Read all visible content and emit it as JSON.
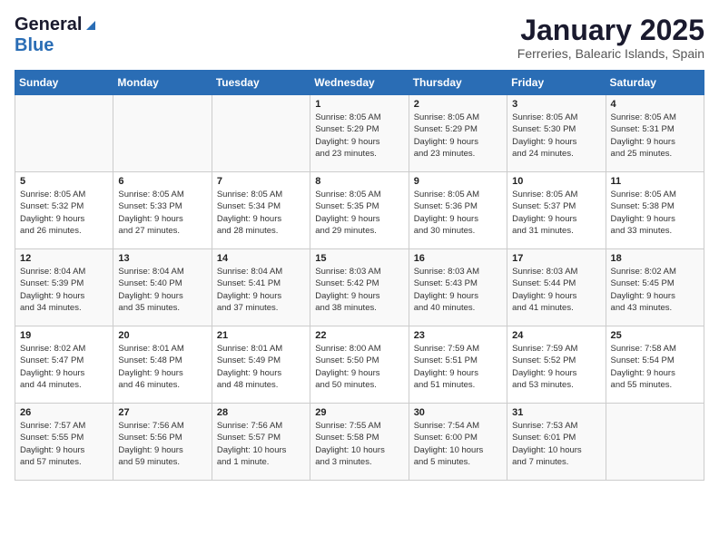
{
  "logo": {
    "general": "General",
    "blue": "Blue"
  },
  "title": "January 2025",
  "subtitle": "Ferreries, Balearic Islands, Spain",
  "weekdays": [
    "Sunday",
    "Monday",
    "Tuesday",
    "Wednesday",
    "Thursday",
    "Friday",
    "Saturday"
  ],
  "weeks": [
    [
      {
        "day": "",
        "content": ""
      },
      {
        "day": "",
        "content": ""
      },
      {
        "day": "",
        "content": ""
      },
      {
        "day": "1",
        "content": "Sunrise: 8:05 AM\nSunset: 5:29 PM\nDaylight: 9 hours\nand 23 minutes."
      },
      {
        "day": "2",
        "content": "Sunrise: 8:05 AM\nSunset: 5:29 PM\nDaylight: 9 hours\nand 23 minutes."
      },
      {
        "day": "3",
        "content": "Sunrise: 8:05 AM\nSunset: 5:30 PM\nDaylight: 9 hours\nand 24 minutes."
      },
      {
        "day": "4",
        "content": "Sunrise: 8:05 AM\nSunset: 5:31 PM\nDaylight: 9 hours\nand 25 minutes."
      }
    ],
    [
      {
        "day": "5",
        "content": "Sunrise: 8:05 AM\nSunset: 5:32 PM\nDaylight: 9 hours\nand 26 minutes."
      },
      {
        "day": "6",
        "content": "Sunrise: 8:05 AM\nSunset: 5:33 PM\nDaylight: 9 hours\nand 27 minutes."
      },
      {
        "day": "7",
        "content": "Sunrise: 8:05 AM\nSunset: 5:34 PM\nDaylight: 9 hours\nand 28 minutes."
      },
      {
        "day": "8",
        "content": "Sunrise: 8:05 AM\nSunset: 5:35 PM\nDaylight: 9 hours\nand 29 minutes."
      },
      {
        "day": "9",
        "content": "Sunrise: 8:05 AM\nSunset: 5:36 PM\nDaylight: 9 hours\nand 30 minutes."
      },
      {
        "day": "10",
        "content": "Sunrise: 8:05 AM\nSunset: 5:37 PM\nDaylight: 9 hours\nand 31 minutes."
      },
      {
        "day": "11",
        "content": "Sunrise: 8:05 AM\nSunset: 5:38 PM\nDaylight: 9 hours\nand 33 minutes."
      }
    ],
    [
      {
        "day": "12",
        "content": "Sunrise: 8:04 AM\nSunset: 5:39 PM\nDaylight: 9 hours\nand 34 minutes."
      },
      {
        "day": "13",
        "content": "Sunrise: 8:04 AM\nSunset: 5:40 PM\nDaylight: 9 hours\nand 35 minutes."
      },
      {
        "day": "14",
        "content": "Sunrise: 8:04 AM\nSunset: 5:41 PM\nDaylight: 9 hours\nand 37 minutes."
      },
      {
        "day": "15",
        "content": "Sunrise: 8:03 AM\nSunset: 5:42 PM\nDaylight: 9 hours\nand 38 minutes."
      },
      {
        "day": "16",
        "content": "Sunrise: 8:03 AM\nSunset: 5:43 PM\nDaylight: 9 hours\nand 40 minutes."
      },
      {
        "day": "17",
        "content": "Sunrise: 8:03 AM\nSunset: 5:44 PM\nDaylight: 9 hours\nand 41 minutes."
      },
      {
        "day": "18",
        "content": "Sunrise: 8:02 AM\nSunset: 5:45 PM\nDaylight: 9 hours\nand 43 minutes."
      }
    ],
    [
      {
        "day": "19",
        "content": "Sunrise: 8:02 AM\nSunset: 5:47 PM\nDaylight: 9 hours\nand 44 minutes."
      },
      {
        "day": "20",
        "content": "Sunrise: 8:01 AM\nSunset: 5:48 PM\nDaylight: 9 hours\nand 46 minutes."
      },
      {
        "day": "21",
        "content": "Sunrise: 8:01 AM\nSunset: 5:49 PM\nDaylight: 9 hours\nand 48 minutes."
      },
      {
        "day": "22",
        "content": "Sunrise: 8:00 AM\nSunset: 5:50 PM\nDaylight: 9 hours\nand 50 minutes."
      },
      {
        "day": "23",
        "content": "Sunrise: 7:59 AM\nSunset: 5:51 PM\nDaylight: 9 hours\nand 51 minutes."
      },
      {
        "day": "24",
        "content": "Sunrise: 7:59 AM\nSunset: 5:52 PM\nDaylight: 9 hours\nand 53 minutes."
      },
      {
        "day": "25",
        "content": "Sunrise: 7:58 AM\nSunset: 5:54 PM\nDaylight: 9 hours\nand 55 minutes."
      }
    ],
    [
      {
        "day": "26",
        "content": "Sunrise: 7:57 AM\nSunset: 5:55 PM\nDaylight: 9 hours\nand 57 minutes."
      },
      {
        "day": "27",
        "content": "Sunrise: 7:56 AM\nSunset: 5:56 PM\nDaylight: 9 hours\nand 59 minutes."
      },
      {
        "day": "28",
        "content": "Sunrise: 7:56 AM\nSunset: 5:57 PM\nDaylight: 10 hours\nand 1 minute."
      },
      {
        "day": "29",
        "content": "Sunrise: 7:55 AM\nSunset: 5:58 PM\nDaylight: 10 hours\nand 3 minutes."
      },
      {
        "day": "30",
        "content": "Sunrise: 7:54 AM\nSunset: 6:00 PM\nDaylight: 10 hours\nand 5 minutes."
      },
      {
        "day": "31",
        "content": "Sunrise: 7:53 AM\nSunset: 6:01 PM\nDaylight: 10 hours\nand 7 minutes."
      },
      {
        "day": "",
        "content": ""
      }
    ]
  ]
}
